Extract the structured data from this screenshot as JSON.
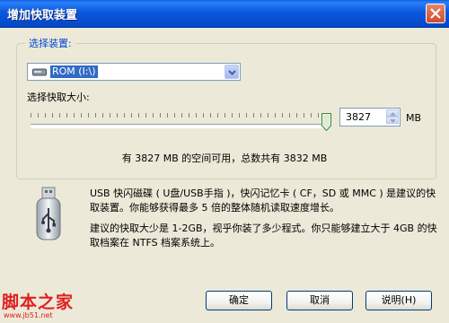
{
  "window": {
    "title": "增加快取装置"
  },
  "device": {
    "group_label": "选择装置:",
    "selected": "ROM (I:\\)",
    "icon": "drive-icon"
  },
  "cache": {
    "size_label": "选择快取大小:",
    "value": "3827",
    "unit": "MB",
    "slider_level": 3827,
    "slider_max": 3832
  },
  "space_text": "有 3827 MB 的空间可用，总数共有 3832 MB",
  "info": {
    "icon": "usb-drive-icon",
    "p1": "USB 快闪磁碟 ( U盘/USB手指 )，快闪记忆卡 ( CF，SD 或 MMC ) 是建议的快取装置。你能够获得最多 5 倍的整体随机读取速度增长。",
    "p2": "建议的快取大少是 1-2GB，视乎你装了多少程式。你只能够建立大于 4GB 的快取档案在 NTFS 档案系统上。"
  },
  "buttons": {
    "ok": "确定",
    "cancel": "取消",
    "help": "说明(H)"
  },
  "watermark": {
    "title": "脚本之家",
    "url": "www.jb51.net"
  },
  "colors": {
    "titlebar": "#0a58de",
    "group_label": "#0046d5",
    "selection": "#316ac5",
    "watermark": "#e02020"
  }
}
